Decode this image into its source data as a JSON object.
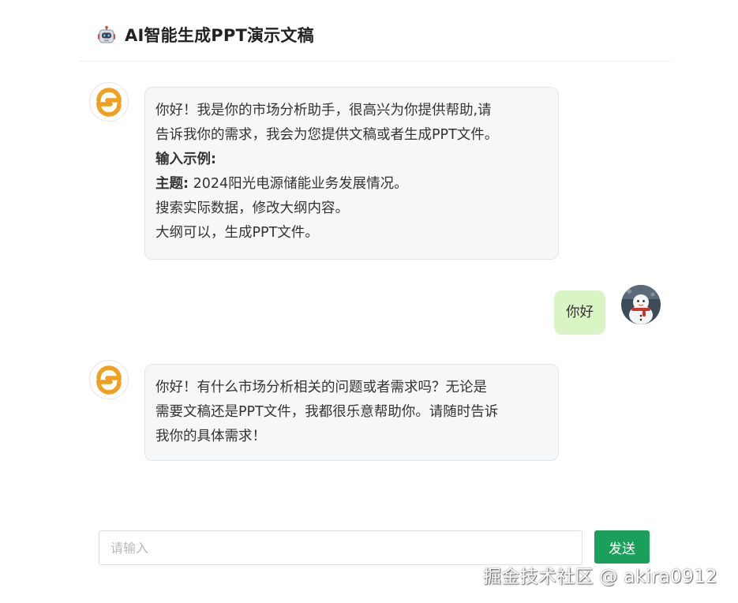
{
  "header": {
    "icon": "robot-icon",
    "title": "AI智能生成PPT演示文稿"
  },
  "messages": [
    {
      "role": "assistant",
      "avatar": "logo-avatar",
      "lines": [
        {
          "text": "你好！我是你的市场分析助手，很高兴为你提供帮助,请"
        },
        {
          "text": "告诉我你的需求，我会为您提供文稿或者生成PPT文件。"
        },
        {
          "bold": "输入示例:"
        },
        {
          "bold": "主题:",
          "text": " 2024阳光电源储能业务发展情况。"
        },
        {
          "text": "搜索实际数据，修改大纲内容。"
        },
        {
          "text": "大纲可以，生成PPT文件。"
        }
      ]
    },
    {
      "role": "user",
      "avatar": "snowman-avatar",
      "text": "你好"
    },
    {
      "role": "assistant",
      "avatar": "logo-avatar",
      "lines": [
        {
          "text": "你好！有什么市场分析相关的问题或者需求吗？无论是"
        },
        {
          "text": "需要文稿还是PPT文件，我都很乐意帮助你。请随时告诉"
        },
        {
          "text": "我你的具体需求！"
        }
      ]
    }
  ],
  "input": {
    "placeholder": "请输入",
    "value": ""
  },
  "send_button": {
    "label": "发送"
  },
  "watermark": "掘金技术社区 @ akira0912",
  "colors": {
    "assistant_bubble": "#f6f7f8",
    "user_bubble": "#d8f5c3",
    "send_button": "#1aa05a",
    "logo_orange": "#f0a020"
  }
}
